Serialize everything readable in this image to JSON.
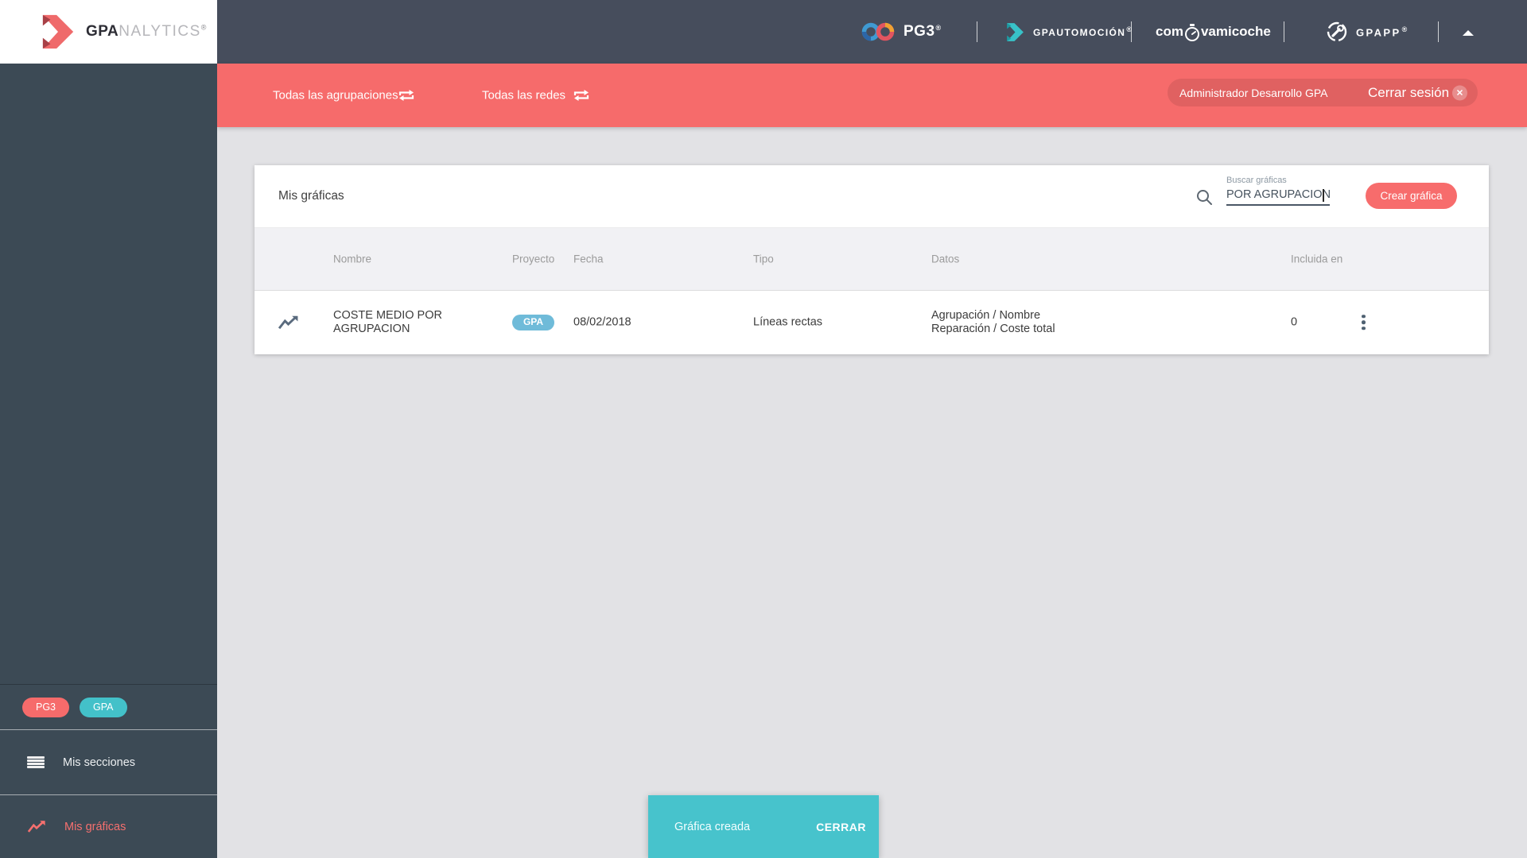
{
  "sidebar": {
    "logo": {
      "bold": "GPA",
      "light": "NALYTICS",
      "registered": "®"
    },
    "badges": [
      {
        "label": "PG3",
        "color": "#f66b6b"
      },
      {
        "label": "GPA",
        "color": "#43c1c9"
      }
    ],
    "items": [
      {
        "label": "Mis secciones",
        "icon": "menu-icon",
        "active": false
      },
      {
        "label": "Mis gráficas",
        "icon": "line-chart-icon",
        "active": true
      }
    ]
  },
  "app_header": {
    "apps": [
      {
        "label": "PG3",
        "registered": "®",
        "icon": "infinity-logo"
      },
      {
        "label": "GPAUTOMOCIÓN",
        "registered": "®",
        "icon": "teal-arrow-logo"
      },
      {
        "label_prefix": "com",
        "label_suffix": "vamicoche",
        "icon": "stopwatch-icon"
      },
      {
        "label": "GPAPP",
        "registered": "®",
        "icon": "wrench-circle-logo"
      }
    ],
    "collapse_icon": "chevron-up-icon"
  },
  "filter_bar": {
    "groupings": "Todas las agrupaciones",
    "networks": "Todas las redes",
    "user": "Administrador Desarrollo GPA",
    "logout": "Cerrar sesión"
  },
  "card": {
    "title": "Mis gráficas",
    "search": {
      "label": "Buscar gráficas",
      "value": "POR AGRUPACION"
    },
    "create_button": "Crear gráfica",
    "table": {
      "columns": [
        "Nombre",
        "Proyecto",
        "Fecha",
        "Tipo",
        "Datos",
        "Incluida en"
      ],
      "rows": [
        {
          "name": [
            "COSTE MEDIO POR",
            "AGRUPACION"
          ],
          "project": "GPA",
          "date": "08/02/2018",
          "type": "Líneas rectas",
          "data": [
            "Agrupación / Nombre",
            "Reparación / Coste total"
          ],
          "included_in": "0"
        }
      ]
    }
  },
  "snackbar": {
    "message": "Gráfica creada",
    "action": "CERRAR"
  },
  "colors": {
    "accent_red": "#f66b6b",
    "snackbar_teal": "#47c3cc",
    "badge_blue": "#6fbbd9",
    "badge_teal": "#43c1c9",
    "header_dark": "#464d5c",
    "sidebar_dark": "#3c4a55",
    "page_bg": "#e2e2e5",
    "table_head_bg": "#f1f1f4"
  }
}
